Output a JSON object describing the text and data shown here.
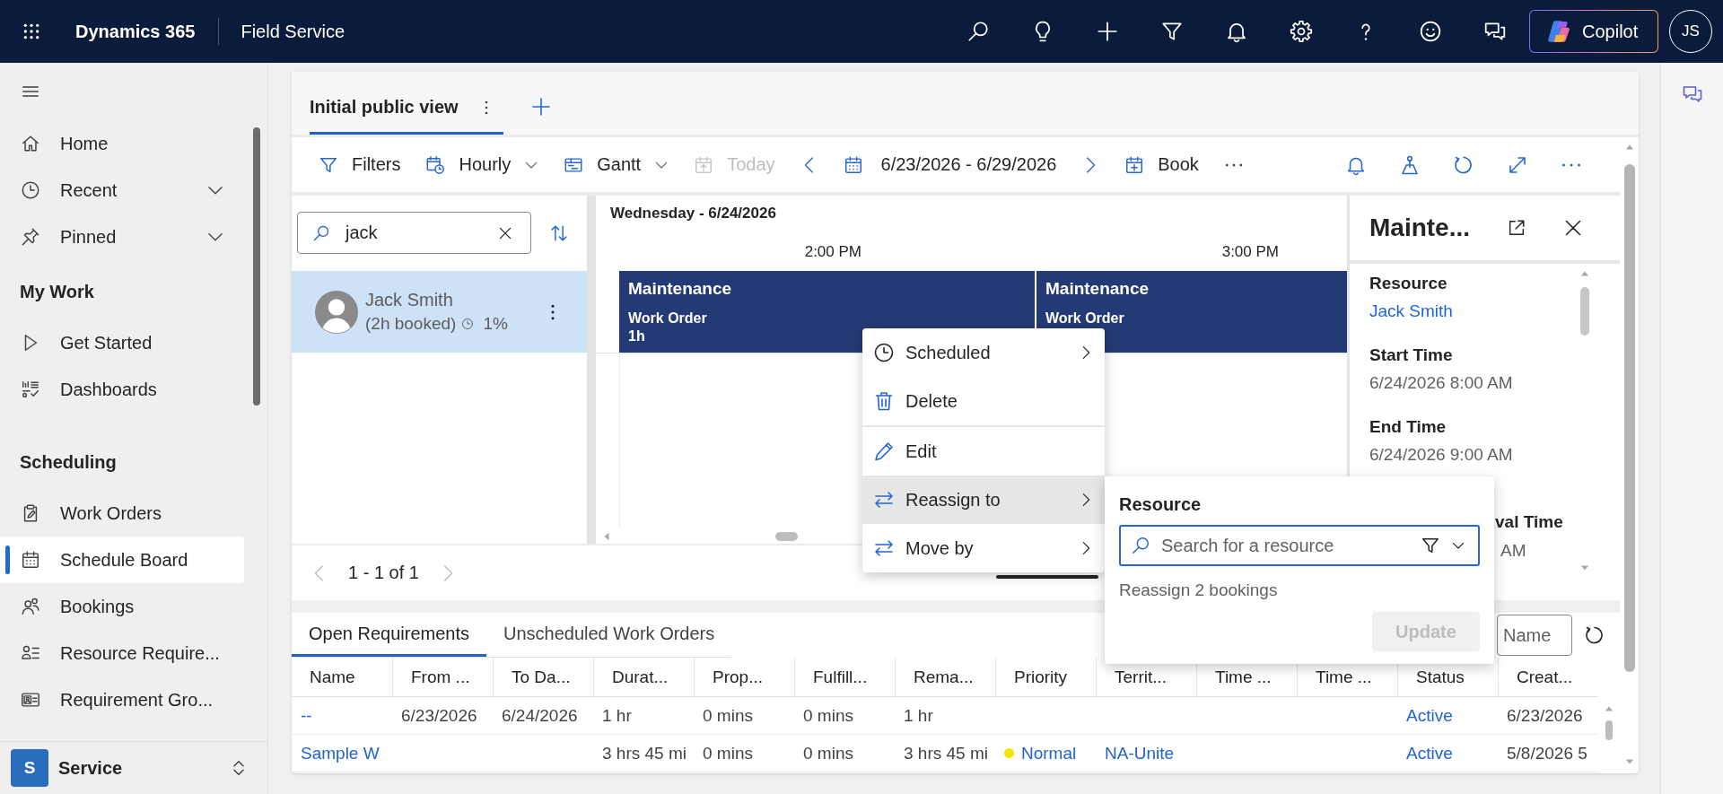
{
  "top_bar": {
    "app_name": "Dynamics 365",
    "area": "Field Service",
    "copilot": "Copilot",
    "user_initials": "JS"
  },
  "sidebar": {
    "top_items": [
      {
        "label": "Home",
        "selected": false
      },
      {
        "label": "Recent",
        "selected": false,
        "expanded": false
      },
      {
        "label": "Pinned",
        "selected": false,
        "expanded": false
      }
    ],
    "groups": [
      {
        "title": "My Work",
        "items": [
          {
            "label": "Get Started",
            "selected": false
          },
          {
            "label": "Dashboards",
            "selected": false
          }
        ]
      },
      {
        "title": "Scheduling",
        "items": [
          {
            "label": "Work Orders",
            "selected": false
          },
          {
            "label": "Schedule Board",
            "selected": true
          },
          {
            "label": "Bookings",
            "selected": false
          },
          {
            "label": "Resource Require...",
            "selected": false
          },
          {
            "label": "Requirement Gro...",
            "selected": false
          }
        ]
      }
    ],
    "area": {
      "initial": "S",
      "name": "Service"
    }
  },
  "view_tabs": [
    {
      "label": "Initial public view",
      "selected": true
    }
  ],
  "toolbar": {
    "buttons": [
      {
        "label": "Filters",
        "kind": "button",
        "disabled": false
      },
      {
        "label": "Hourly",
        "kind": "dropdown",
        "disabled": false
      },
      {
        "label": "Gantt",
        "kind": "dropdown",
        "disabled": false
      },
      {
        "label": "Today",
        "kind": "button",
        "disabled": true
      }
    ],
    "date_range": "6/23/2026 - 6/29/2026",
    "book": {
      "label": "Book",
      "disabled": false
    }
  },
  "resource_search": {
    "value": "jack"
  },
  "resources": [
    {
      "name": "Jack Smith",
      "booked": "(2h booked)",
      "utilization": "1%",
      "selected": true
    }
  ],
  "gantt": {
    "day": "Wednesday - 6/24/2026",
    "times": [
      "2:00 PM",
      "3:00 PM"
    ],
    "bookings": [
      {
        "title": "Maintenance",
        "type": "Work Order",
        "duration": "1h"
      },
      {
        "title": "Maintenance",
        "type": "Work Order"
      }
    ]
  },
  "pagination": {
    "label": "1 - 1 of 1",
    "prev_disabled": true,
    "next_disabled": true
  },
  "details": {
    "title": "Mainte...",
    "fields": [
      {
        "label": "Resource",
        "value": "Jack Smith",
        "kind": "link"
      },
      {
        "label": "Start Time",
        "value": "6/24/2026 8:00 AM",
        "kind": "text"
      },
      {
        "label": "End Time",
        "value": "6/24/2026 9:00 AM",
        "kind": "text"
      }
    ],
    "partly_hidden_field": {
      "label": "val Time",
      "value": "AM"
    }
  },
  "context_menu": {
    "items": [
      {
        "label": "Scheduled",
        "submenu": true,
        "divider_above": false,
        "selected": false
      },
      {
        "label": "Delete",
        "submenu": false,
        "divider_above": false,
        "selected": false
      },
      {
        "label": "Edit",
        "submenu": false,
        "divider_above": true,
        "selected": false
      },
      {
        "label": "Reassign to",
        "submenu": true,
        "divider_above": false,
        "selected": true
      },
      {
        "label": "Move by",
        "submenu": true,
        "divider_above": false,
        "selected": false
      }
    ]
  },
  "reassign_popup": {
    "label": "Resource",
    "placeholder": "Search for a resource",
    "note": "Reassign 2 bookings",
    "button": {
      "label": "Update",
      "disabled": true
    }
  },
  "requirements": {
    "tabs": [
      {
        "label": "Open Requirements",
        "selected": true
      },
      {
        "label": "Unscheduled Work Orders",
        "selected": false
      }
    ],
    "name_filter": {
      "placeholder": "Name"
    },
    "columns": [
      "Name",
      "From ...",
      "To Da...",
      "Durat...",
      "Prop...",
      "Fulfill...",
      "Rema...",
      "Priority",
      "Territ...",
      "Time ...",
      "Time ...",
      "Status",
      "Creat..."
    ],
    "rows": [
      {
        "cells": [
          {
            "kind": "link",
            "text": "--"
          },
          {
            "kind": "text",
            "text": "6/23/2026"
          },
          {
            "kind": "text",
            "text": "6/24/2026"
          },
          {
            "kind": "text",
            "text": "1 hr"
          },
          {
            "kind": "text",
            "text": "0 mins"
          },
          {
            "kind": "text",
            "text": "0 mins"
          },
          {
            "kind": "text",
            "text": "1 hr"
          },
          {
            "kind": "empty"
          },
          {
            "kind": "empty"
          },
          {
            "kind": "empty"
          },
          {
            "kind": "empty"
          },
          {
            "kind": "link",
            "text": "Active"
          },
          {
            "kind": "text",
            "text": "6/23/2026"
          }
        ]
      },
      {
        "cells": [
          {
            "kind": "link",
            "text": "Sample W"
          },
          {
            "kind": "empty"
          },
          {
            "kind": "empty"
          },
          {
            "kind": "text",
            "text": "3 hrs 45 mi"
          },
          {
            "kind": "text",
            "text": "0 mins"
          },
          {
            "kind": "text",
            "text": "0 mins"
          },
          {
            "kind": "text",
            "text": "3 hrs 45 mi"
          },
          {
            "kind": "priority",
            "text": "Normal",
            "color": "#f2e500"
          },
          {
            "kind": "link",
            "text": "NA-Unite"
          },
          {
            "kind": "empty"
          },
          {
            "kind": "empty"
          },
          {
            "kind": "link",
            "text": "Active"
          },
          {
            "kind": "text",
            "text": "5/8/2026 5"
          }
        ]
      }
    ]
  }
}
